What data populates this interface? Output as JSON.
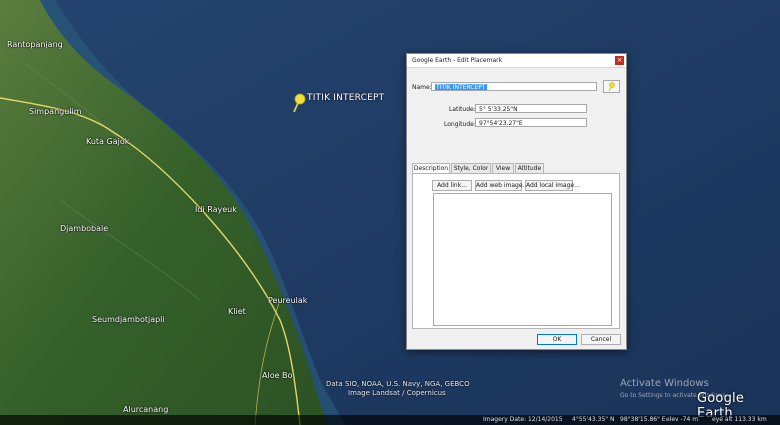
{
  "map": {
    "places": [
      "Rantopanjang",
      "Simpangulim",
      "Kuta Gajok",
      "Idi Rayeuk",
      "Djambobale",
      "Peureulak",
      "Kliet",
      "Seumdjambotjapli",
      "Aloe Bo",
      "Alurcanang"
    ],
    "placemark_label": "TITIK INTERCEPT",
    "credits": [
      "Data SIO, NOAA, U.S. Navy, NGA, GEBCO",
      "Image Landsat / Copernicus"
    ],
    "activate": {
      "title": "Activate Windows",
      "subtitle": "Go to Settings to activate Windows."
    },
    "logo": "Google Earth",
    "status": {
      "imagery_date": "Imagery Date: 12/14/2015",
      "lat": "4°55'43.35\" N",
      "lon": "98°38'15.86\" E",
      "elev": "elev  -74 m",
      "eye": "eye alt 113.33 km"
    }
  },
  "dialog": {
    "title": "Google Earth - Edit Placemark",
    "name_label": "Name:",
    "name_value": "TITIK INTERCEPT",
    "latitude_label": "Latitude:",
    "latitude_value": "5° 5'33.25\"N",
    "longitude_label": "Longitude:",
    "longitude_value": "97°54'23.27\"E",
    "tabs": [
      "Description",
      "Style, Color",
      "View",
      "Altitude"
    ],
    "buttons": {
      "add_link": "Add link...",
      "add_web_image": "Add web image...",
      "add_local_image": "Add local image...",
      "ok": "OK",
      "cancel": "Cancel"
    },
    "close_glyph": "×"
  },
  "colors": {
    "ocean": "#1f3a63",
    "land": "#3d6a2e",
    "road": "#e4d66a",
    "selection": "#3399ff",
    "close": "#c42b1c"
  },
  "icons": {
    "placemark": "yellow-pushpin-icon"
  }
}
